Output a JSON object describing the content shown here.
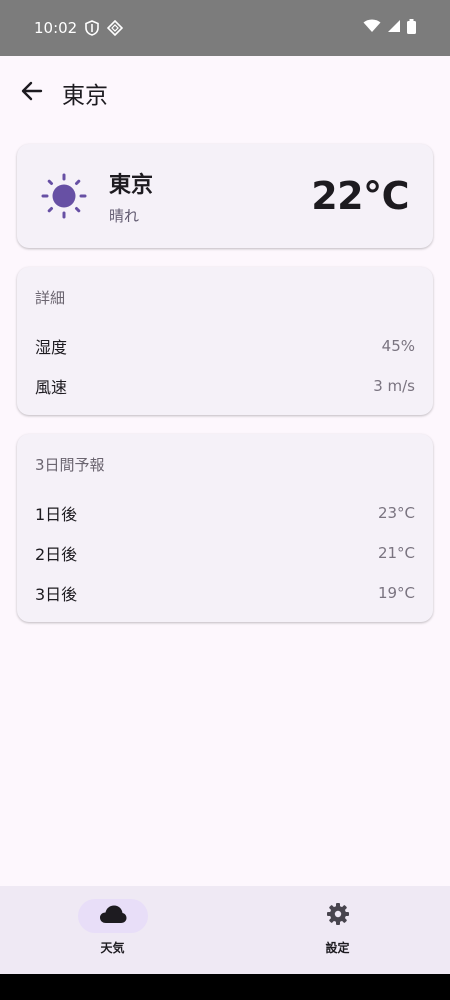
{
  "status_bar": {
    "time": "10:02"
  },
  "app_bar": {
    "title": "東京"
  },
  "current": {
    "city": "東京",
    "condition": "晴れ",
    "temperature": "22°C",
    "icon": "sun-icon",
    "icon_color": "#6750a4"
  },
  "details": {
    "heading": "詳細",
    "rows": [
      {
        "label": "湿度",
        "value": "45%"
      },
      {
        "label": "風速",
        "value": "3 m/s"
      }
    ]
  },
  "forecast": {
    "heading": "3日間予報",
    "rows": [
      {
        "label": "1日後",
        "value": "23°C"
      },
      {
        "label": "2日後",
        "value": "21°C"
      },
      {
        "label": "3日後",
        "value": "19°C"
      }
    ]
  },
  "bottom_nav": {
    "items": [
      {
        "label": "天気",
        "icon": "cloud-icon",
        "active": true
      },
      {
        "label": "設定",
        "icon": "gear-icon",
        "active": false
      }
    ]
  }
}
